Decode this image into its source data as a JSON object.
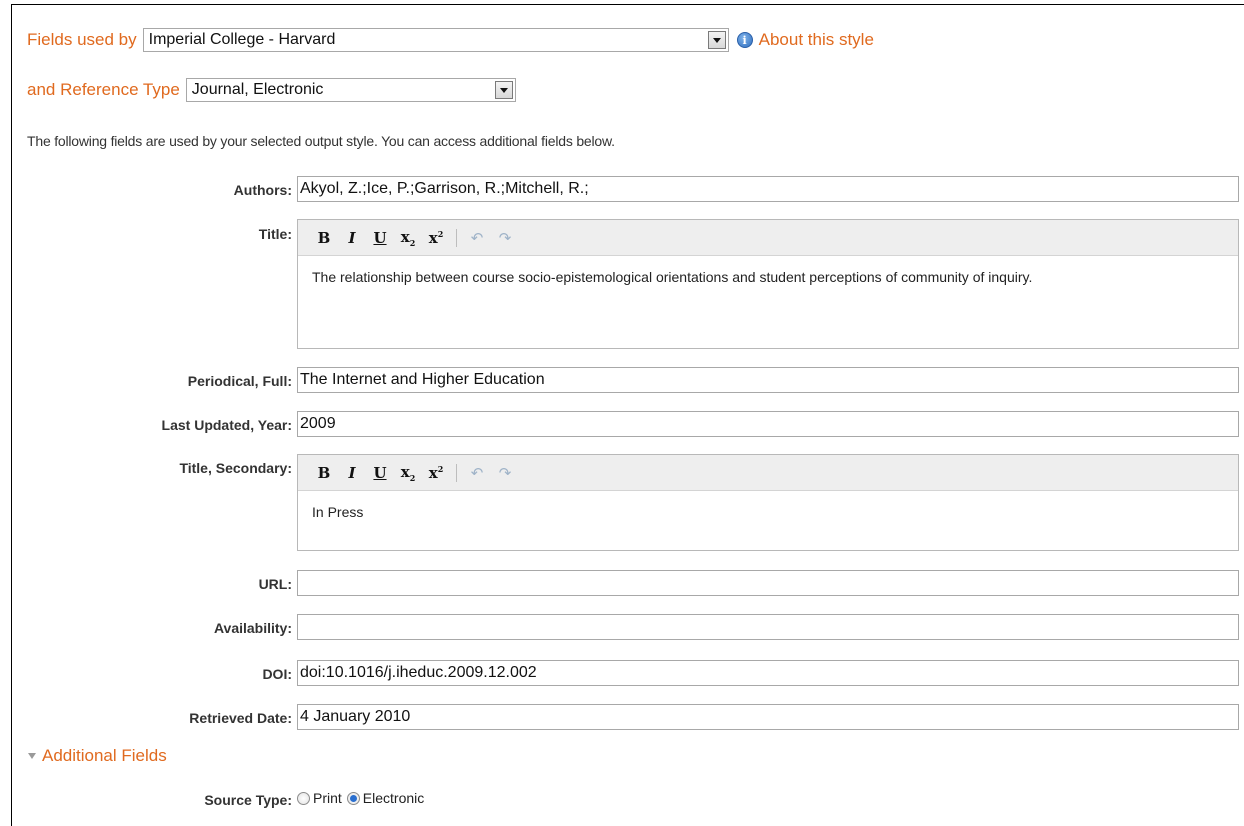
{
  "header": {
    "fields_used_by_label": "Fields used by",
    "style_value": "Imperial College - Harvard",
    "about_link": "About this style",
    "ref_type_label": "and Reference Type",
    "ref_type_value": "Journal, Electronic",
    "intro": "The following fields are used by your selected output style. You can access additional fields below."
  },
  "fields": {
    "authors": {
      "label": "Authors:",
      "value": "Akyol, Z.;Ice, P.;Garrison, R.;Mitchell, R.;"
    },
    "title": {
      "label": "Title:",
      "value": "The relationship between course socio-epistemological orientations and student perceptions of community of inquiry."
    },
    "periodical": {
      "label": "Periodical, Full:",
      "value": "The Internet and Higher Education"
    },
    "year": {
      "label": "Last Updated, Year:",
      "value": "2009"
    },
    "title_secondary": {
      "label": "Title, Secondary:",
      "value": "In Press"
    },
    "url": {
      "label": "URL:",
      "value": ""
    },
    "availability": {
      "label": "Availability:",
      "value": ""
    },
    "doi": {
      "label": "DOI:",
      "value": "doi:10.1016/j.iheduc.2009.12.002"
    },
    "retrieved": {
      "label": "Retrieved Date:",
      "value": "4 January 2010"
    }
  },
  "toolbar": {
    "bold": "B",
    "italic": "I",
    "underline": "U",
    "subscript": "x",
    "superscript": "x",
    "undo": "↶",
    "redo": "↷"
  },
  "additional": {
    "label": "Additional Fields"
  },
  "source_type": {
    "label": "Source Type:",
    "options": [
      {
        "label": "Print",
        "checked": false
      },
      {
        "label": "Electronic",
        "checked": true
      }
    ]
  },
  "colors": {
    "accent": "#e06a1f",
    "info_blue": "#2f6fbf",
    "radio_blue": "#2a6fcf"
  },
  "icons": {
    "info": "info-icon",
    "disclosure": "triangle-down-icon"
  }
}
